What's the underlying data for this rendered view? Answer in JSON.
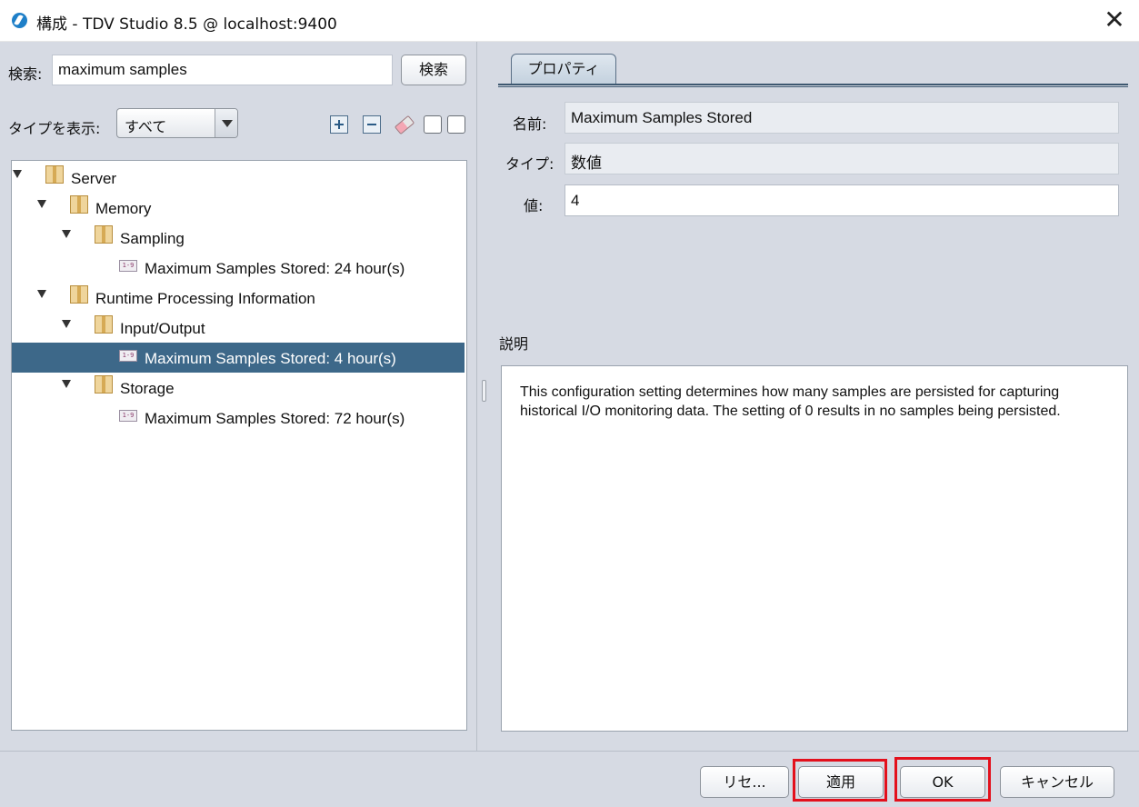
{
  "window": {
    "title": "構成 - TDV Studio 8.5 @ localhost:9400",
    "close_glyph": "✕"
  },
  "search": {
    "label": "検索:",
    "value": "maximum samples",
    "button_label": "検索"
  },
  "type_filter": {
    "label": "タイプを表示:",
    "selected": "すべて"
  },
  "tree": {
    "items": [
      {
        "label": "Server",
        "kind": "folder",
        "depth": 0
      },
      {
        "label": "Memory",
        "kind": "folder",
        "depth": 1
      },
      {
        "label": "Sampling",
        "kind": "folder",
        "depth": 2
      },
      {
        "label": "Maximum Samples Stored: 24 hour(s)",
        "kind": "setting",
        "depth": 3
      },
      {
        "label": "Runtime Processing Information",
        "kind": "folder",
        "depth": 1
      },
      {
        "label": "Input/Output",
        "kind": "folder",
        "depth": 2
      },
      {
        "label": "Maximum Samples Stored: 4 hour(s)",
        "kind": "setting",
        "depth": 3,
        "selected": true
      },
      {
        "label": "Storage",
        "kind": "folder",
        "depth": 2
      },
      {
        "label": "Maximum Samples Stored: 72 hour(s)",
        "kind": "setting",
        "depth": 3
      }
    ],
    "setting_icon_text": "1-9"
  },
  "properties": {
    "tab_label": "プロパティ",
    "name_label": "名前:",
    "name_value": "Maximum Samples Stored",
    "type_label": "タイプ:",
    "type_value": "数値",
    "value_label": "値:",
    "value_value": "4"
  },
  "description": {
    "label": "説明",
    "text": "This configuration setting determines how many samples are persisted for capturing historical I/O monitoring data. The setting of 0 results in no samples being persisted."
  },
  "footer": {
    "reset_label": "リセ...",
    "apply_label": "適用",
    "ok_label": "OK",
    "cancel_label": "キャンセル"
  },
  "colors": {
    "selection": "#3d6889",
    "highlight": "#e3101c",
    "panel_bg": "#d6dae3"
  }
}
